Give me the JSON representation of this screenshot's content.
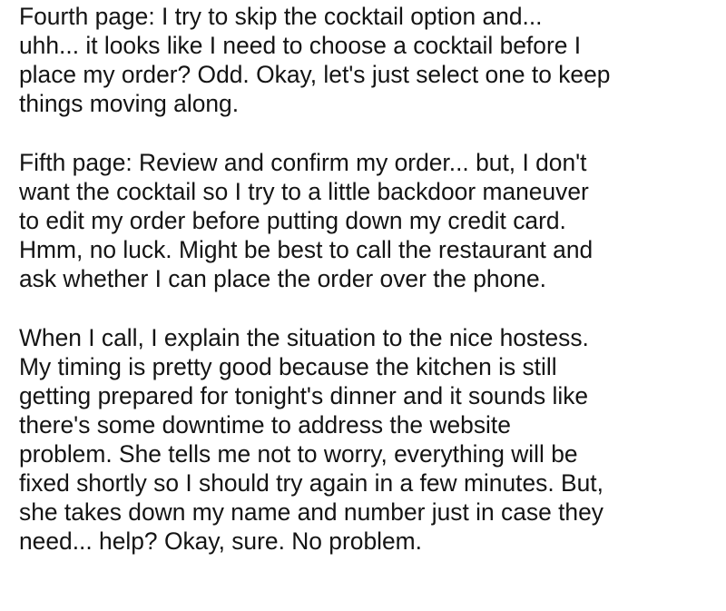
{
  "paragraphs": [
    {
      "lines": [
        "Fourth page: I try to skip the cocktail option and...",
        "uhh... it looks like I need to choose a cocktail before I",
        "place my order? Odd. Okay, let's just select one to keep",
        "things moving along."
      ]
    },
    {
      "lines": [
        "Fifth page: Review and confirm my order... but, I don't",
        "want the cocktail so I try to a little backdoor maneuver",
        "to edit my order before putting down my credit card.",
        "Hmm, no luck. Might be best to call the restaurant and",
        "ask whether I can place the order over the phone."
      ]
    },
    {
      "lines": [
        "When I call, I explain the situation to the nice hostess.",
        "My timing is pretty good because the kitchen is still",
        "getting prepared for tonight's dinner and it sounds like",
        "there's some downtime to address the website",
        "problem. She tells me not to worry, everything will be",
        "fixed shortly so I should try again in a few minutes. But,",
        "she takes down my name and number just in case they",
        "need... help? Okay, sure. No problem."
      ]
    }
  ]
}
